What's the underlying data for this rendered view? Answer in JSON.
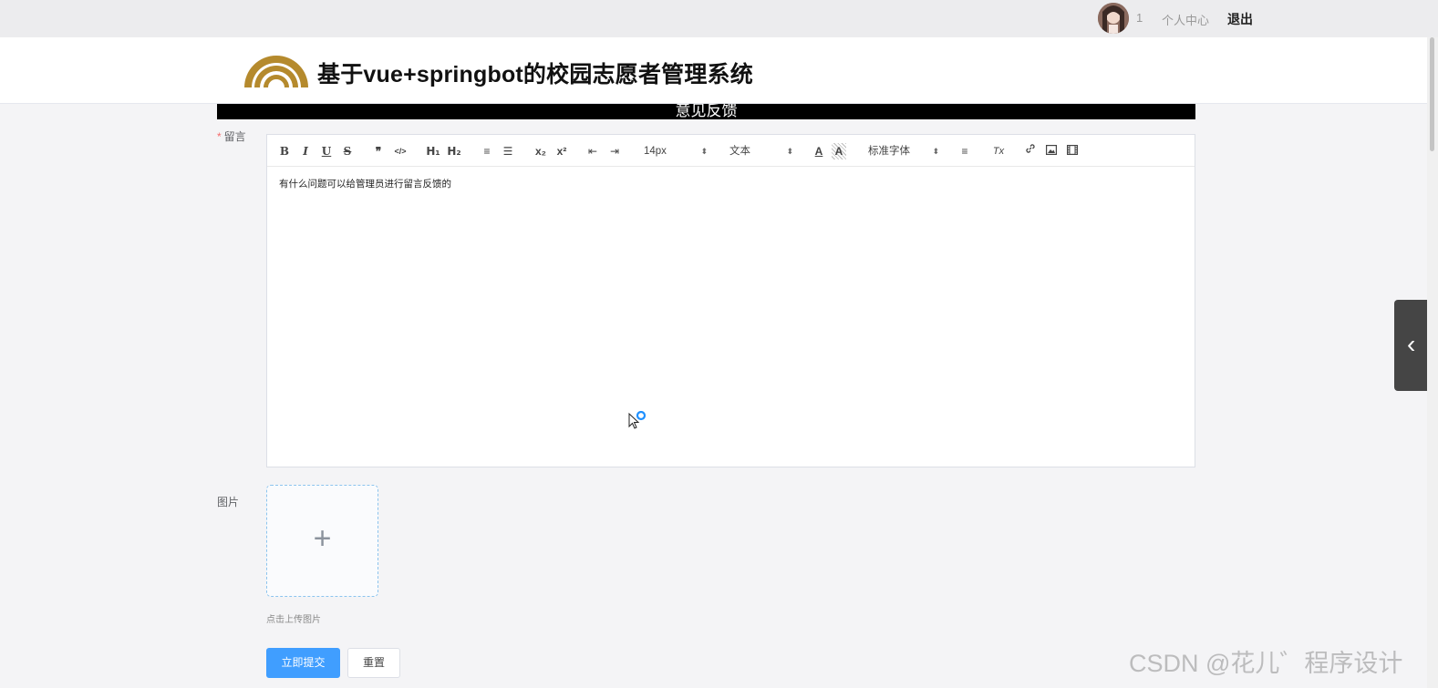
{
  "topbar": {
    "user_id": "1",
    "profile_label": "个人中心",
    "logout_label": "退出"
  },
  "header": {
    "site_title": "基于vue+springbot的校园志愿者管理系统",
    "logo_color": "#b58a2d"
  },
  "section_title": "意见反馈",
  "form": {
    "message_label": "留言",
    "message_required_mark": "*",
    "image_label": "图片",
    "upload_plus": "+",
    "upload_tip": "点击上传图片",
    "submit_label": "立即提交",
    "reset_label": "重置"
  },
  "editor": {
    "content": "有什么问题可以给管理员进行留言反馈的",
    "toolbar": {
      "bold": "B",
      "italic": "I",
      "underline": "U",
      "strike": "S",
      "blockquote": "❞",
      "code": "</>",
      "h1": "H₁",
      "h2": "H₂",
      "ordered_list": "≡",
      "bullet_list": "☰",
      "subscript": "x₂",
      "superscript": "x²",
      "outdent": "⇤",
      "indent": "⇥",
      "font_size": "14px",
      "header_select": "文本",
      "font_color": "A",
      "background_color": "A",
      "font_family": "标准字体",
      "align": "≡",
      "clean": "Tx",
      "link": "🔗",
      "image": "▣",
      "video": "▦"
    }
  },
  "colors": {
    "primary": "#409eff",
    "required": "#f56c6c",
    "strip": "#000000"
  },
  "watermark": "CSDN @花儿゛程序设计"
}
